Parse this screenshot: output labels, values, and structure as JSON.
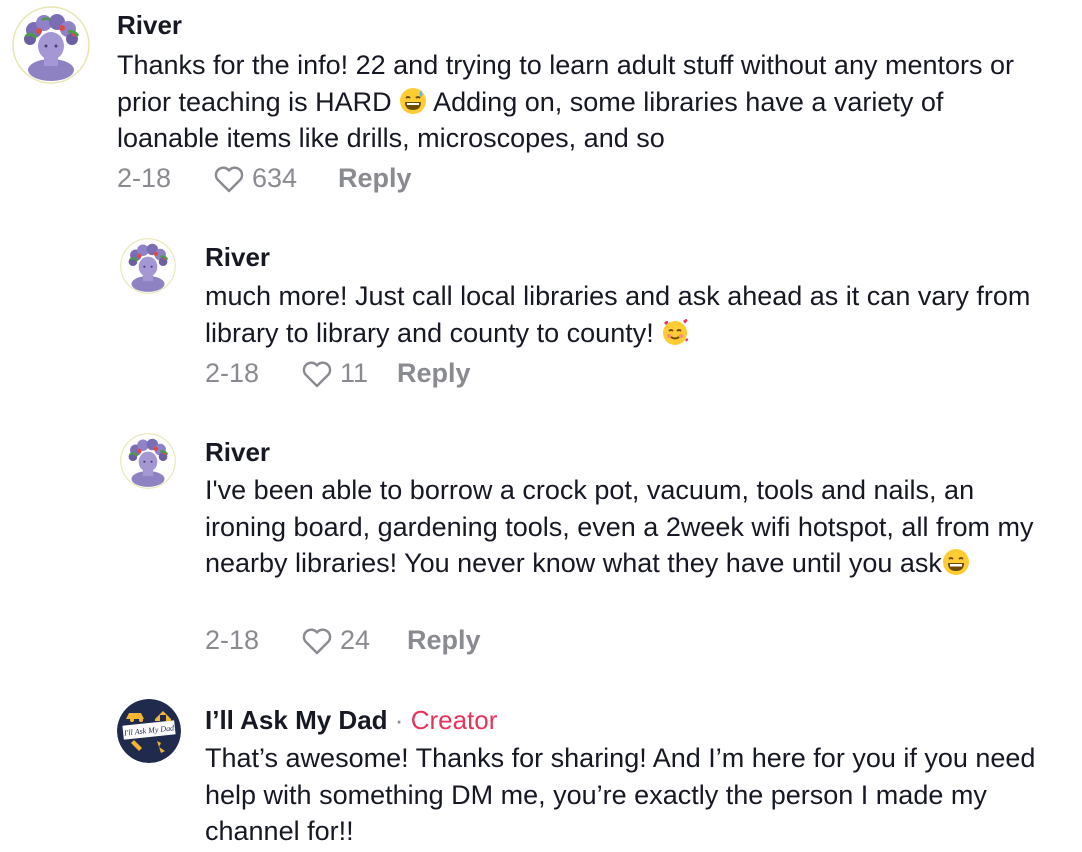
{
  "comments": [
    {
      "username": "River",
      "text_before_emoji": "Thanks for the info! 22 and trying to learn adult stuff without any mentors or prior teaching is HARD",
      "text_after_emoji": " Adding on, some libraries have a variety of loanable items like drills, microscopes, and so",
      "date": "2-18",
      "likes": "634",
      "reply_label": "Reply"
    },
    {
      "username": "River",
      "text_before_emoji": "much more! Just call local libraries and ask ahead as it can vary from library to library and county to county!",
      "text_after_emoji": "",
      "date": "2-18",
      "likes": "11",
      "reply_label": "Reply"
    },
    {
      "username": "River",
      "text_before_emoji": "I've been able to borrow a crock pot, vacuum, tools and nails, an ironing board, gardening tools, even a 2week wifi hotspot, all from my nearby libraries! You never know what they have until you ask",
      "text_after_emoji": "",
      "date": "2-18",
      "likes": "24",
      "reply_label": "Reply"
    },
    {
      "username": "I’ll Ask My Dad",
      "separator": "·",
      "creator_label": "Creator",
      "avatar_text": "I'll Ask My Dad",
      "text": "That’s awesome! Thanks for sharing! And I’m here for you if you need help with something DM me, you’re exactly the person I made my channel for!!"
    }
  ],
  "colors": {
    "text": "#161823",
    "meta": "#8a8b91",
    "creator": "#e8335b",
    "creator_avatar_bg": "#1f2a4d",
    "creator_avatar_accent": "#f2b632"
  },
  "icons": {
    "like": "heart-outline-icon",
    "emoji_1": "grinning-sweat-emoji",
    "emoji_2": "smiling-hearts-emoji",
    "emoji_3": "beaming-grin-emoji"
  }
}
